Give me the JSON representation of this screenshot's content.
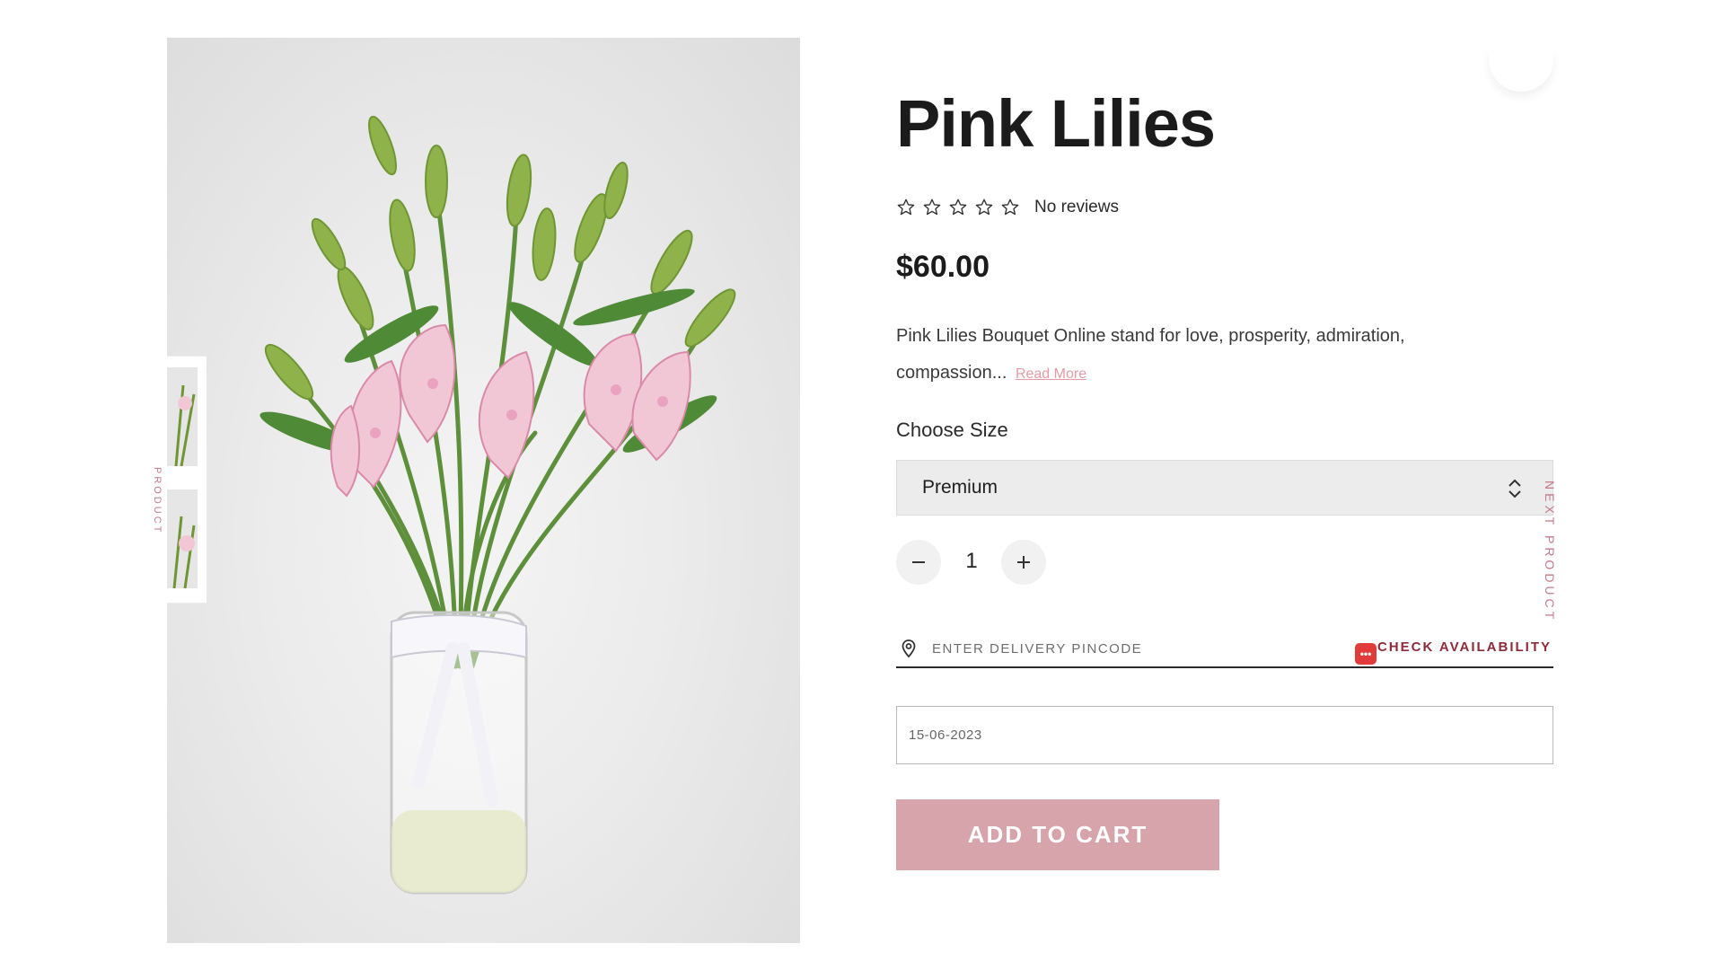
{
  "product": {
    "title": "Pink Lilies",
    "price": "$60.00",
    "reviews_text": "No reviews",
    "rating": 0,
    "rating_max": 5,
    "description": "Pink Lilies Bouquet Online stand for love, prosperity, admiration, compassion...",
    "read_more_label": "Read More"
  },
  "size": {
    "label": "Choose Size",
    "selected": "Premium"
  },
  "quantity": {
    "value": "1"
  },
  "delivery": {
    "pincode_placeholder": "ENTER DELIVERY PINCODE",
    "check_label": "CHECK AVAILABILITY",
    "date_value": "15-06-2023"
  },
  "cart": {
    "add_label": "ADD TO CART"
  },
  "nav": {
    "next_label": "NEXT PRODUCT",
    "prev_label": "PRODUCT"
  },
  "colors": {
    "button_pink": "#d6a4aa",
    "accent_rose": "#c27b8a",
    "check_text": "#8e2a3a",
    "chat_red": "#e23b3b"
  },
  "icons": [
    "star-icon",
    "chevron-updown-icon",
    "minus-icon",
    "plus-icon",
    "location-pin-icon",
    "chat-icon"
  ]
}
